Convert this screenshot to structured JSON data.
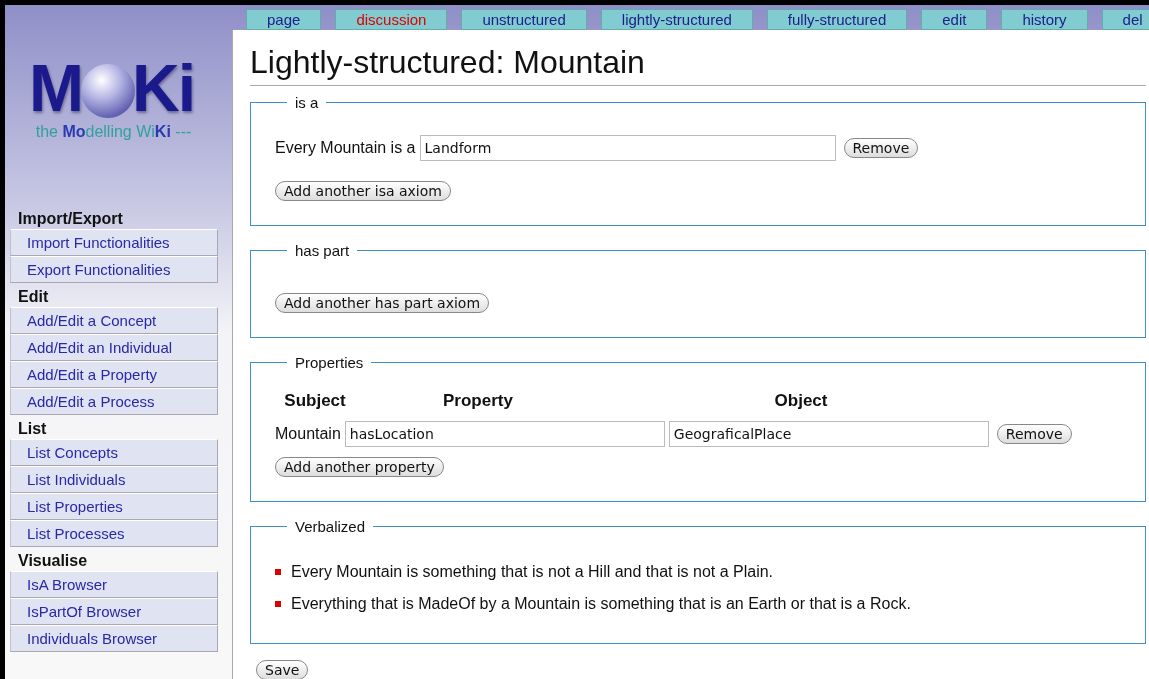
{
  "logo": {
    "first": "M",
    "last": "Ki",
    "tagline": "the **Mo**delling Wi**Ki** ---"
  },
  "tabs": [
    {
      "label": "page",
      "missing": false
    },
    {
      "label": "discussion",
      "missing": true
    },
    {
      "label": "unstructured",
      "missing": false
    },
    {
      "label": "lightly-structured",
      "missing": false
    },
    {
      "label": "fully-structured",
      "missing": false
    },
    {
      "label": "edit",
      "missing": false
    },
    {
      "label": "history",
      "missing": false
    },
    {
      "label": "del",
      "missing": false
    }
  ],
  "sidebar": [
    {
      "heading": "Import/Export",
      "items": [
        "Import Functionalities",
        "Export Functionalities"
      ]
    },
    {
      "heading": "Edit",
      "items": [
        "Add/Edit a Concept",
        "Add/Edit an Individual",
        "Add/Edit a Property",
        "Add/Edit a Process"
      ]
    },
    {
      "heading": "List",
      "items": [
        "List Concepts",
        "List Individuals",
        "List Properties",
        "List Processes"
      ]
    },
    {
      "heading": "Visualise",
      "items": [
        "IsA Browser",
        "IsPartOf Browser",
        "Individuals Browser"
      ]
    }
  ],
  "title": "Lightly-structured: Mountain",
  "sections": [
    {
      "kind": "axioms",
      "legend": "is a",
      "rows": [
        {
          "label": "Every Mountain is a",
          "value": "Landform",
          "button": "Remove"
        }
      ],
      "add_button": "Add another isa axiom"
    },
    {
      "kind": "axioms",
      "legend": "has part",
      "add_button": "Add another has part axiom"
    },
    {
      "kind": "properties",
      "legend": "Properties",
      "headers": [
        "Subject",
        "Property",
        "Object"
      ],
      "rows": [
        {
          "subject": "Mountain",
          "property": "hasLocation",
          "object": "GeograficalPlace",
          "button": "Remove"
        }
      ],
      "add_button": "Add another property"
    },
    {
      "kind": "verbalized",
      "legend": "Verbalized",
      "items": [
        "Every Mountain is something that is not a Hill and that is not a Plain.",
        "Everything that is MadeOf by a Mountain is something that is an Earth or that is a Rock."
      ]
    }
  ],
  "save_button": "Save"
}
